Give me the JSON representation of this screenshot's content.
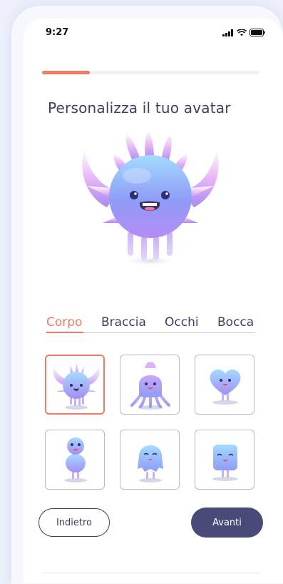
{
  "status_bar": {
    "time": "9:27",
    "icons": [
      "signal-icon",
      "wifi-icon",
      "battery-icon"
    ]
  },
  "progress": {
    "value": 0.22,
    "fill_color": "#f07a68",
    "track_color": "#f1f1f3"
  },
  "header": {
    "title": "Personalizza il tuo avatar"
  },
  "tabs": [
    {
      "label": "Corpo",
      "active": true
    },
    {
      "label": "Braccia",
      "active": false
    },
    {
      "label": "Occhi",
      "active": false
    },
    {
      "label": "Bocca",
      "active": false
    }
  ],
  "options": [
    {
      "name": "spiky-monster",
      "selected": true
    },
    {
      "name": "tentacle-monster",
      "selected": false
    },
    {
      "name": "heart-monster",
      "selected": false
    },
    {
      "name": "peanut-monster",
      "selected": false
    },
    {
      "name": "ghost-monster",
      "selected": false
    },
    {
      "name": "square-monster",
      "selected": false
    }
  ],
  "buttons": {
    "back_label": "Indietro",
    "next_label": "Avanti"
  },
  "colors": {
    "accent": "#f07a68",
    "primary": "#484b77",
    "text": "#3c3f63"
  }
}
